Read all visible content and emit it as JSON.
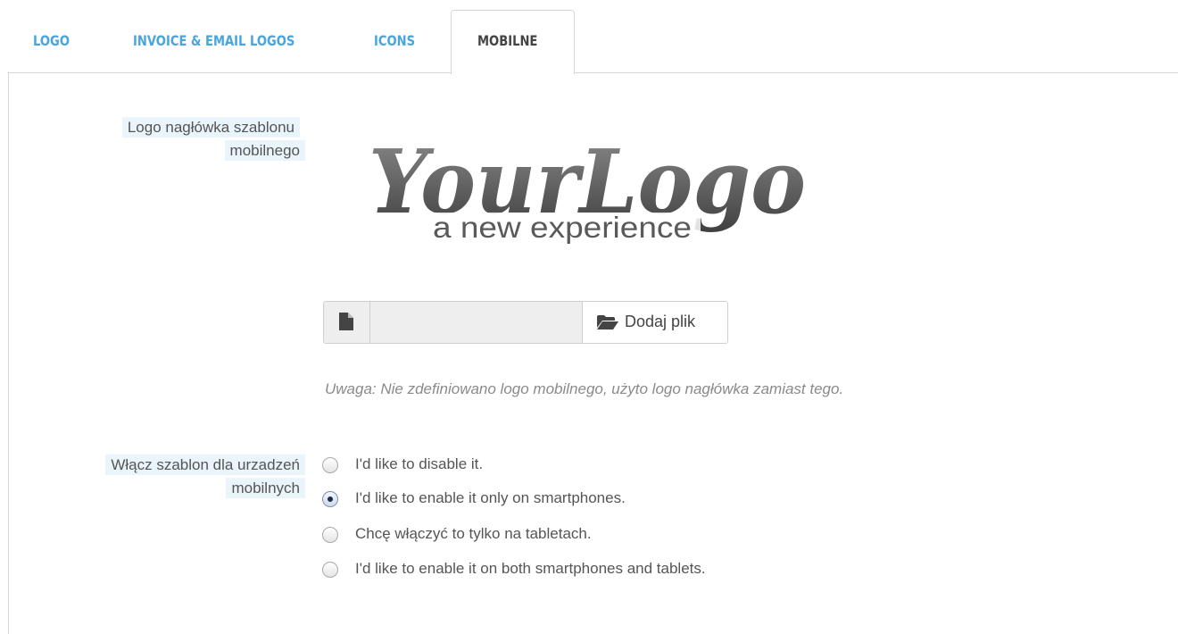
{
  "tabs": [
    {
      "label": "LOGO",
      "active": false
    },
    {
      "label": "INVOICE & EMAIL LOGOS",
      "active": false
    },
    {
      "label": "ICONS",
      "active": false
    },
    {
      "label": "MOBILNE",
      "active": true
    }
  ],
  "mobile_logo": {
    "label": "Logo nagłówka szablonu mobilnego",
    "logo_script_text": "YourLogo",
    "logo_tagline": "a new experience",
    "file_input_value": "",
    "add_file_button": "Dodaj plik",
    "note": "Uwaga: Nie zdefiniowano logo mobilnego, użyto logo nagłówka zamiast tego."
  },
  "mobile_theme": {
    "label": "Włącz szablon dla urzadzeń mobilnych",
    "options": [
      {
        "label": "I'd like to disable it.",
        "checked": false
      },
      {
        "label": "I'd like to enable it only on smartphones.",
        "checked": true
      },
      {
        "label": "Chcę włączyć to tylko na tabletach.",
        "checked": false
      },
      {
        "label": "I'd like to enable it on both smartphones and tablets.",
        "checked": false
      }
    ]
  },
  "colors": {
    "tab_link": "#4aa5dc",
    "label_highlight": "#e9f4fb",
    "border": "#d6d6d6"
  },
  "icons": {
    "file": "file-icon",
    "folder": "folder-open-icon"
  }
}
